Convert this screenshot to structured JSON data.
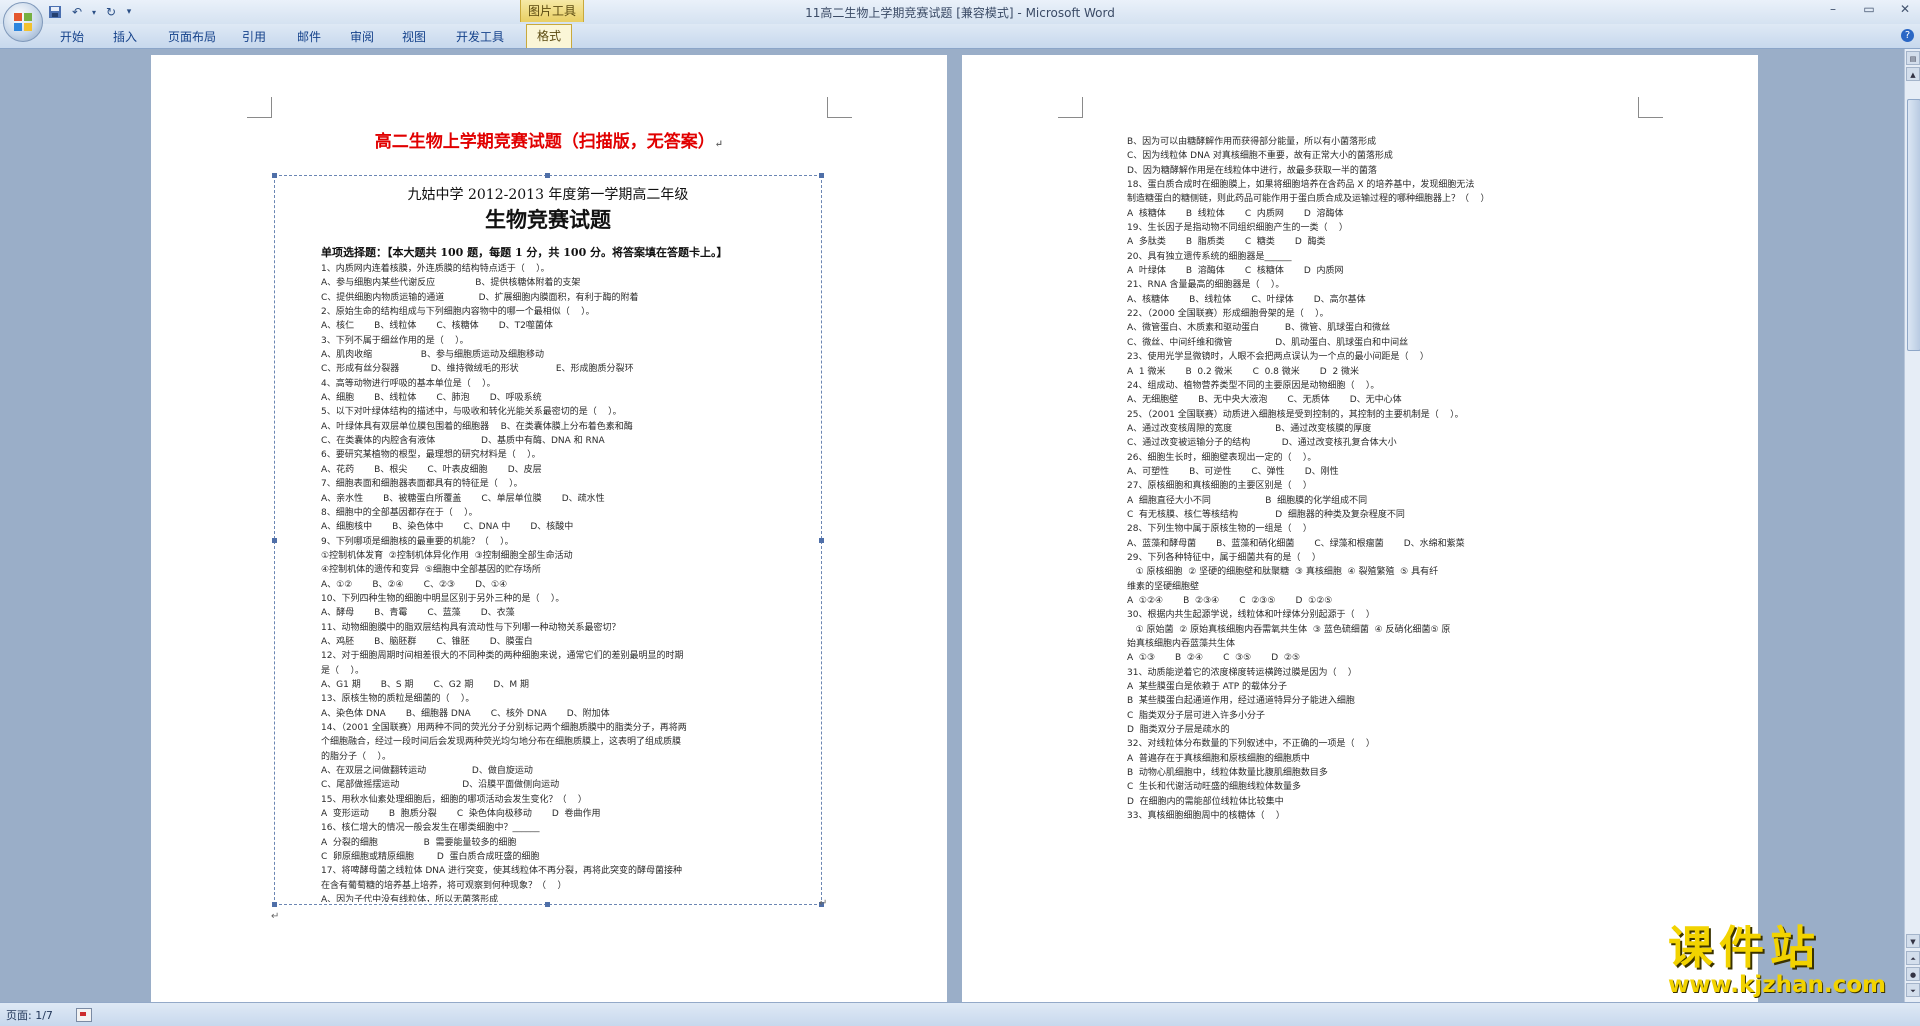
{
  "window": {
    "title": "11高二生物上学期竞赛试题 [兼容模式] - Microsoft Word",
    "context_tab": "图片工具",
    "controls": [
      "–",
      "▭",
      "✕"
    ]
  },
  "qat": {
    "save": "save-icon",
    "undo": "undo-icon",
    "redo": "redo-icon",
    "customize": "▾"
  },
  "tabs": [
    "开始",
    "插入",
    "页面布局",
    "引用",
    "邮件",
    "审阅",
    "视图",
    "开发工具",
    "格式"
  ],
  "document": {
    "title": "高二生物上学期竞赛试题（扫描版，无答案）",
    "paragraph_mark": "↵",
    "scan": {
      "school_line": "九姑中学 2012-2013 年度第一学期高二年级",
      "title": "生物竞赛试题",
      "instructions": "单项选择题：【本大题共 100 题，每题 1 分，共 100 分。将答案填在答题卡上。】",
      "left_lines": [
        "1、内质网内连着核膜，外连质膜的结构特点适于（    ）。",
        "A、参与细胞内某些代谢反应              B、提供核糖体附着的支架",
        "C、提供细胞内物质运输的通道            D、扩展细胞内膜面积，有利于酶的附着",
        "2、原始生命的结构组成与下列细胞内容物中的哪一个最相似（    ）。",
        "A、核仁       B、线粒体       C、核糖体       D、T2噬菌体",
        "3、下列不属于细丝作用的是（    ）。",
        "A、肌肉收缩                 B、参与细胞质运动及细胞移动",
        "C、形成有丝分裂器           D、维持微绒毛的形状             E、形成胞质分裂环",
        "4、高等动物进行呼吸的基本单位是（    ）。",
        "A、细胞       B、线粒体       C、肺泡       D、呼吸系统",
        "5、以下对叶绿体结构的描述中，与吸收和转化光能关系最密切的是（    ）。",
        "A、叶绿体具有双层单位膜包围着的细胞器    B、在类囊体膜上分布着色素和酶",
        "C、在类囊体的内腔含有液体                D、基质中有酶、DNA 和 RNA",
        "6、要研究某植物的根型，最理想的研究材料是（    ）。",
        "A、花药       B、根尖       C、叶表皮细胞       D、皮层",
        "7、细胞表面和细胞器表面都具有的特征是（    ）。",
        "A、亲水性       B、被糖蛋白所覆盖       C、单层单位膜       D、疏水性",
        "8、细胞中的全部基因都存在于（    ）。",
        "A、细胞核中       B、染色体中       C、DNA 中       D、核酸中",
        "9、下列哪项是细胞核的最重要的机能？（    ）。",
        "①控制机体发育  ②控制机体异化作用  ③控制细胞全部生命活动",
        "④控制机体的遗传和变异  ⑤细胞中全部基因的贮存场所",
        "A、①②       B、②④       C、②③       D、①④",
        "10、下列四种生物的细胞中明显区别于另外三种的是（    ）。",
        "A、酵母       B、青霉       C、蓝藻       D、衣藻",
        "11、动物细胞膜中的脂双层结构具有流动性与下列哪一种动物关系最密切？",
        "A、鸡胚       B、脑胚群       C、锥胚       D、膜蛋白",
        "12、对于细胞周期时间相差很大的不同种类的两种细胞来说，通常它们的差别最明显的时期",
        "是（    ）。",
        "A、G1 期       B、S 期       C、G2 期       D、M 期",
        "13、原核生物的质粒是细菌的（    ）。",
        "A、染色体 DNA       B、细胞器 DNA       C、核外 DNA       D、附加体",
        "14、（2001 全国联赛）用两种不同的荧光分子分别标记两个细胞质膜中的脂类分子，再将两",
        "个细胞融合，经过一段时间后会发现两种荧光均匀地分布在细胞质膜上，这表明了组成质膜",
        "的脂分子（    ）。",
        "A、在双层之间做翻转运动                D、做自旋运动",
        "C、尾部做摇摆运动                      D、沿膜平面做侧向运动",
        "15、用秋水仙素处理细胞后，细胞的哪项活动会发生变化？（    ）",
        "A  变形运动       B  胞质分裂       C  染色体向极移动       D  卷曲作用",
        "16、核仁增大的情况一般会发生在哪类细胞中？______",
        "A  分裂的细胞                B  需要能量较多的细胞",
        "C  卵原细胞或精原细胞        D  蛋白质合成旺盛的细胞",
        "17、将啤酵母菌之线粒体 DNA 进行突变，使其线粒体不再分裂，再将此突变的酵母菌接种",
        "在含有葡萄糖的培养基上培养，将可观察到何种现象？（    ）",
        "A、因为子代中没有线粒体，所以无菌落形成"
      ],
      "right_lines": [
        "B、因为可以由糖酵解作用而获得部分能量，所以有小菌落形成",
        "C、因为线粒体 DNA 对真核细胞不重要，故有正常大小的菌落形成",
        "D、因为糖酵解作用是在线粒体中进行，故最多获取一半的菌落",
        "18、蛋白质合成时在细胞膜上，如果将细胞培养在含药品 X 的培养基中，发现细胞无法",
        "制造糖蛋白的糖侧链，则此药品可能作用于蛋白质合成及运输过程的哪种细胞器上？（    ）",
        "A  核糖体       B  线粒体       C  内质网       D  溶酶体",
        "19、生长因子是指动物不同组织细胞产生的一类（    ）",
        "A  多肽类       B  脂质类       C  糖类       D  酶类",
        "20、具有独立遗传系统的细胞器是______",
        "A  叶绿体       B  溶酶体       C  核糖体       D  内质网",
        "21、RNA 含量最高的细胞器是（    ）。",
        "A、核糖体       B、线粒体       C、叶绿体       D、高尔基体",
        "22、（2000 全国联赛）形成细胞骨架的是（    ）。",
        "A、微管蛋白、木质素和驱动蛋白         B、微管、肌球蛋白和微丝",
        "C、微丝、中间纤维和微管               D、肌动蛋白、肌球蛋白和中间丝",
        "23、使用光学显微镜时，人眼不会把两点误认为一个点的最小间距是（    ）",
        "A  1 微米       B  0.2 微米       C  0.8 微米       D  2 微米",
        "24、组成动、植物营养类型不同的主要原因是动物细胞（    ）。",
        "A、无细胞壁       B、无中央大液泡       C、无质体       D、无中心体",
        "25、（2001 全国联赛）动质进入细胞核是受到控制的，其控制的主要机制是（    ）。",
        "A、通过改变核周隙的宽度               B、通过改变核膜的厚度",
        "C、通过改变被运输分子的结构           D、通过改变核孔复合体大小",
        "26、细胞生长时，细胞壁表现出一定的（    ）。",
        "A、可塑性       B、可逆性       C、弹性       D、刚性",
        "27、原核细胞和真核细胞的主要区别是（    ）",
        "A  细胞直径大小不同                   B  细胞膜的化学组成不同",
        "C  有无核膜、核仁等核结构             D  细胞器的种类及复杂程度不同",
        "28、下列生物中属于原核生物的一组是（    ）",
        "A、蓝藻和酵母菌       B、蓝藻和硝化细菌       C、绿藻和根瘤菌       D、水绵和紫菜",
        "29、下列各种特征中，属于细菌共有的是（    ）",
        "   ① 原核细胞  ② 坚硬的细胞壁和肽聚糖  ③ 真核细胞  ④ 裂殖繁殖  ⑤ 具有纤",
        "维素的坚硬细胞壁",
        "A  ①②④       B  ②③④       C  ②③⑤       D  ①②⑤",
        "30、根据内共生起源学说，线粒体和叶绿体分别起源于（    ）",
        "   ① 原始菌  ② 原始真核细胞内吞需氧共生体  ③ 蓝色硫细菌  ④ 反硝化细菌⑤ 原",
        "始真核细胞内吞蓝藻共生体",
        "A  ①③       B  ②④       C  ③⑤       D  ②⑤",
        "31、动质能逆着它的浓度梯度转运横跨过膜是因为（    ）",
        "A  某些膜蛋白是依赖于 ATP 的载体分子",
        "B  某些膜蛋白起通道作用，经过通道特异分子能进入细胞",
        "C  脂类双分子层可进入许多小分子",
        "D  脂类双分子层是疏水的",
        "32、对线粒体分布数量的下列叙述中，不正确的一项是（    ）",
        "A  普遍存在于真核细胞和原核细胞的细胞质中",
        "B  动物心肌细胞中，线粒体数量比腹肌细胞数目多",
        "C  生长和代谢活动旺盛的细胞线粒体数量多",
        "D  在细胞内的需能部位线粒体比较集中",
        "33、真核细胞细胞周中的核糖体（    ）"
      ]
    }
  },
  "statusbar": {
    "page": "页面: 1/7"
  },
  "watermark": {
    "cn": "课件站",
    "url": "www.kjzhan.com"
  }
}
